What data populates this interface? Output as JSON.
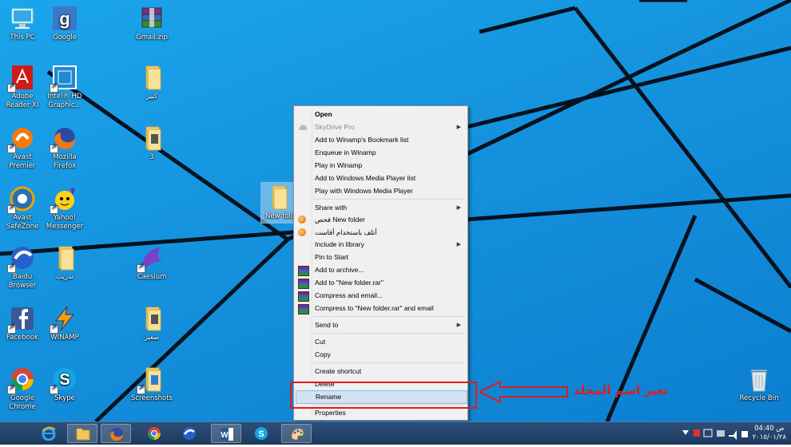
{
  "desktop_icons": [
    {
      "id": "this-pc",
      "label": "This PC"
    },
    {
      "id": "google",
      "label": "Google"
    },
    {
      "id": "gmail-zip",
      "label": "Gmail.zip"
    },
    {
      "id": "adobe",
      "label": "Adobe Reader XI"
    },
    {
      "id": "intel",
      "label": "Intel® HD Graphic..."
    },
    {
      "id": "folder-kabir",
      "label": "كبير"
    },
    {
      "id": "avast",
      "label": "Avast Premier"
    },
    {
      "id": "firefox",
      "label": "Mozilla Firefox"
    },
    {
      "id": "folder-3",
      "label": "3"
    },
    {
      "id": "avast-safezone",
      "label": "Avast SafeZone"
    },
    {
      "id": "yahoo",
      "label": "Yahoo! Messenger"
    },
    {
      "id": "new-folder",
      "label": "New fold"
    },
    {
      "id": "baidu",
      "label": "Baidu Browser"
    },
    {
      "id": "folder-tadrib",
      "label": "تدريب"
    },
    {
      "id": "caesium",
      "label": "Caesium"
    },
    {
      "id": "facebook",
      "label": "Facebook"
    },
    {
      "id": "winamp",
      "label": "WINAMP"
    },
    {
      "id": "folder-saghir",
      "label": "صغير"
    },
    {
      "id": "chrome",
      "label": "Google Chrome"
    },
    {
      "id": "skype",
      "label": "Skype"
    },
    {
      "id": "screenshots",
      "label": "Screenshots"
    },
    {
      "id": "recycle",
      "label": "Recycle Bin"
    }
  ],
  "context_menu": {
    "open": "Open",
    "skydrive": "SkyDrive Pro",
    "winamp_bookmark": "Add to Winamp's Bookmark list",
    "enqueue": "Enqueue in Winamp",
    "play_winamp": "Play in Winamp",
    "wmp_list": "Add to Windows Media Player list",
    "wmp_play": "Play with Windows Media Player",
    "share": "Share with",
    "scan": "فحص New folder",
    "shred": "أتلف باستخدام أفاست",
    "library": "Include in library",
    "pin": "Pin to Start",
    "archive": "Add to archive...",
    "add_rar": "Add to \"New folder.rar\"",
    "compress_email": "Compress and email...",
    "compress_rar_email": "Compress to \"New folder.rar\" and email",
    "send_to": "Send to",
    "cut": "Cut",
    "copy": "Copy",
    "shortcut": "Create shortcut",
    "delete": "Delete",
    "rename": "Rename",
    "properties": "Properties"
  },
  "annotation": "تغير اسم المجلد",
  "clock": {
    "time": "ص 04:40",
    "date": "٢٠١٥/٠١/٢٨"
  }
}
